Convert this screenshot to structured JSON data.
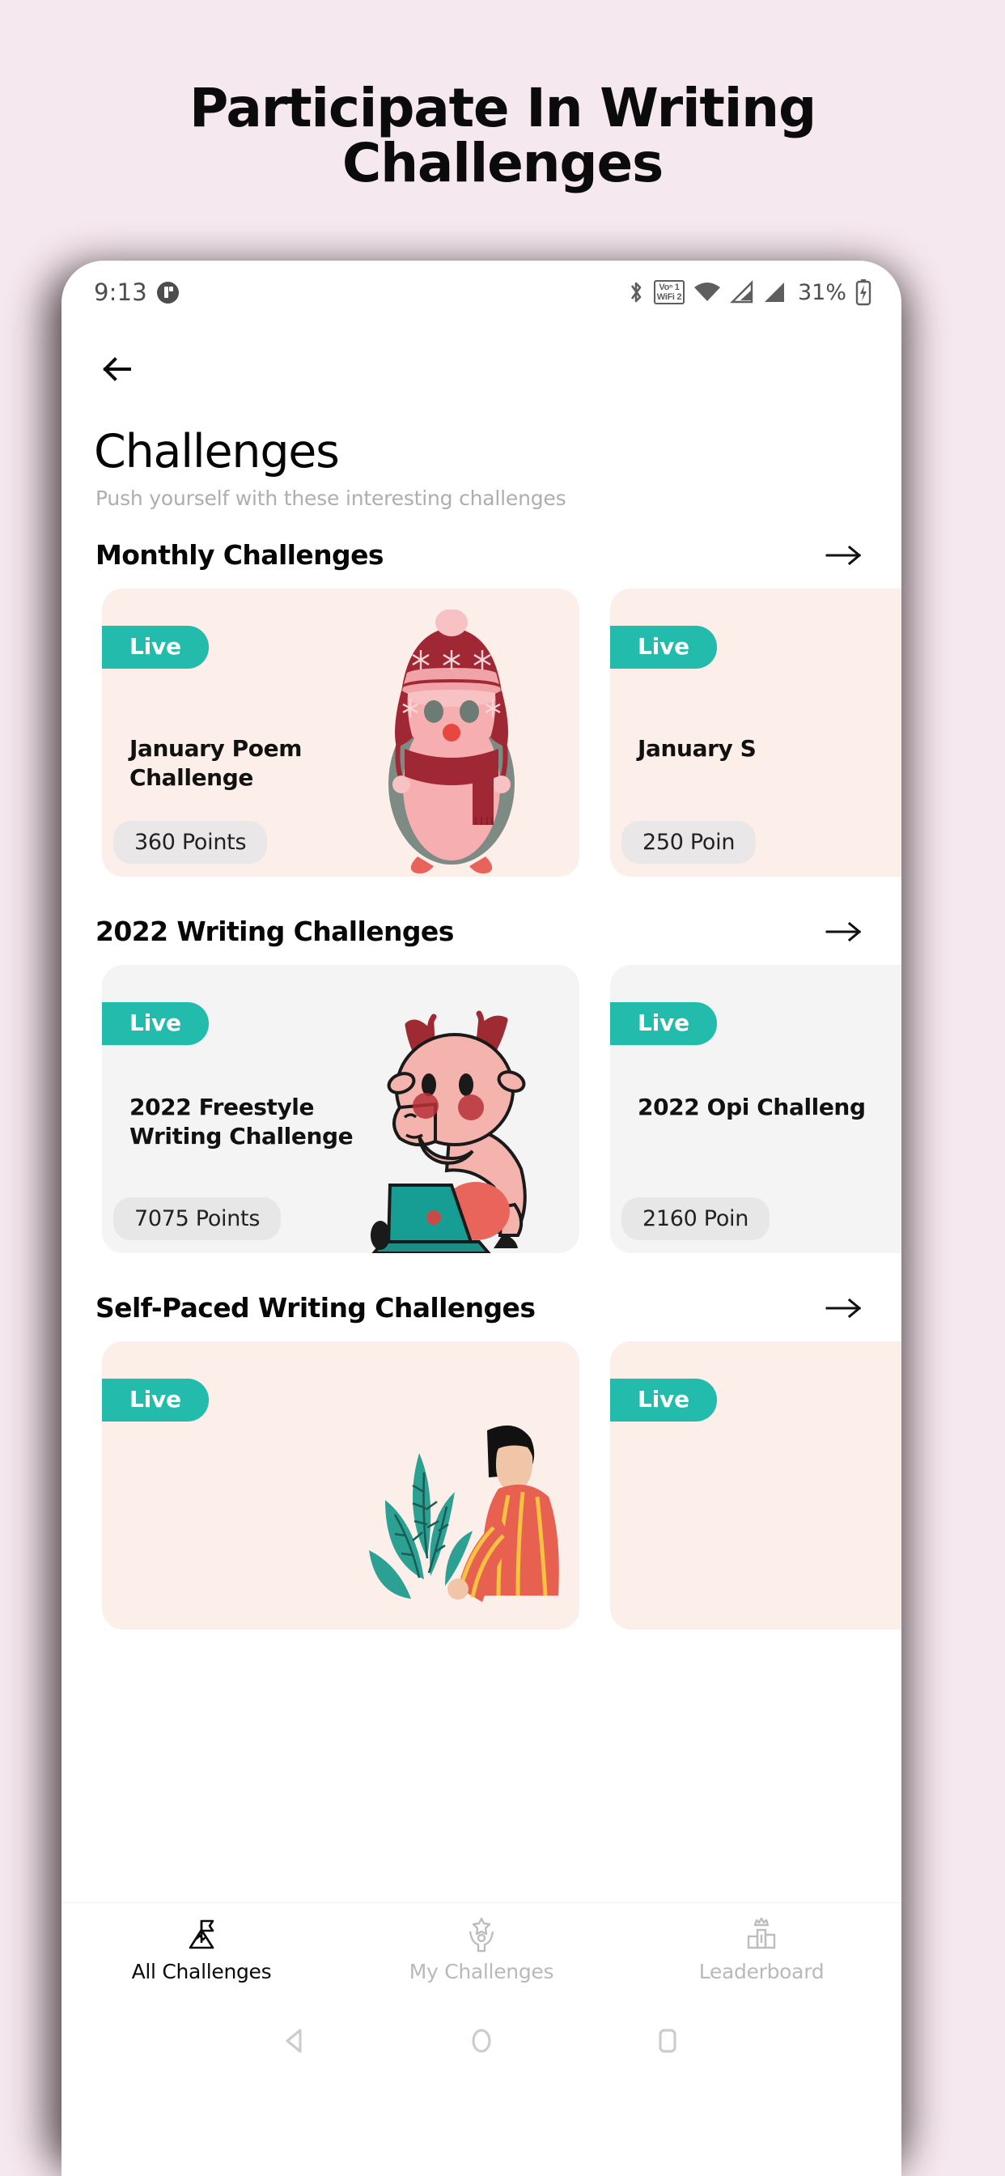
{
  "promo": {
    "headline": "Participate In Writing Challenges"
  },
  "colors": {
    "page_background": "#F6E8EF",
    "accent_teal": "#23BBAB",
    "card_pink": "#FCEFEA",
    "card_gray": "#F4F4F4",
    "points_pill": "#E9E7E7",
    "title_black": "#050505",
    "subtitle_gray": "#AEAEAE",
    "nav_inactive": "#B9B9B9"
  },
  "status_bar": {
    "time": "9:13",
    "app_icon": "app-badge-icon",
    "icons": [
      "bluetooth-icon",
      "vowifi-icon",
      "wifi-icon",
      "signal-sim1-icon",
      "signal-sim2-icon",
      "battery-charging-icon"
    ],
    "vowifi_line1": "Voⁿ 1",
    "vowifi_line2": "WiFi 2",
    "battery_percent": "31%"
  },
  "app": {
    "back_icon": "back-arrow-icon",
    "title": "Challenges",
    "subtitle": "Push yourself with these interesting challenges",
    "sections": [
      {
        "title": "Monthly Challenges",
        "arrow_icon": "arrow-right-icon",
        "cards": [
          {
            "badge": "Live",
            "title": "January Poem Challenge",
            "points": "360 Points",
            "theme": "pink",
            "art": "penguin-winter-hat-illustration"
          },
          {
            "badge": "Live",
            "title": "January S",
            "points": "250 Poin",
            "theme": "pink",
            "art": "clipped-illustration"
          }
        ]
      },
      {
        "title": "2022 Writing Challenges",
        "arrow_icon": "arrow-right-icon",
        "cards": [
          {
            "badge": "Live",
            "title": "2022 Freestyle Writing Challenge",
            "points": "7075 Points",
            "theme": "gray",
            "art": "deer-with-laptop-illustration"
          },
          {
            "badge": "Live",
            "title": "2022 Opi Challeng",
            "points": "2160 Poin",
            "theme": "gray",
            "art": "clipped-illustration"
          }
        ]
      },
      {
        "title": "Self-Paced Writing Challenges",
        "arrow_icon": "arrow-right-icon",
        "cards": [
          {
            "badge": "Live",
            "title": "",
            "points": "",
            "theme": "pink",
            "art": "person-with-plant-illustration"
          },
          {
            "badge": "Live",
            "title": "",
            "points": "",
            "theme": "pink",
            "art": "clipped-illustration"
          }
        ]
      }
    ]
  },
  "bottom_nav": {
    "items": [
      {
        "label": "All Challenges",
        "icon": "mountain-flag-icon",
        "active": true
      },
      {
        "label": "My Challenges",
        "icon": "person-star-icon",
        "active": false
      },
      {
        "label": "Leaderboard",
        "icon": "podium-crown-icon",
        "active": false
      }
    ]
  },
  "system_nav": {
    "back": "android-back-icon",
    "home": "android-home-icon",
    "recents": "android-recents-icon"
  }
}
